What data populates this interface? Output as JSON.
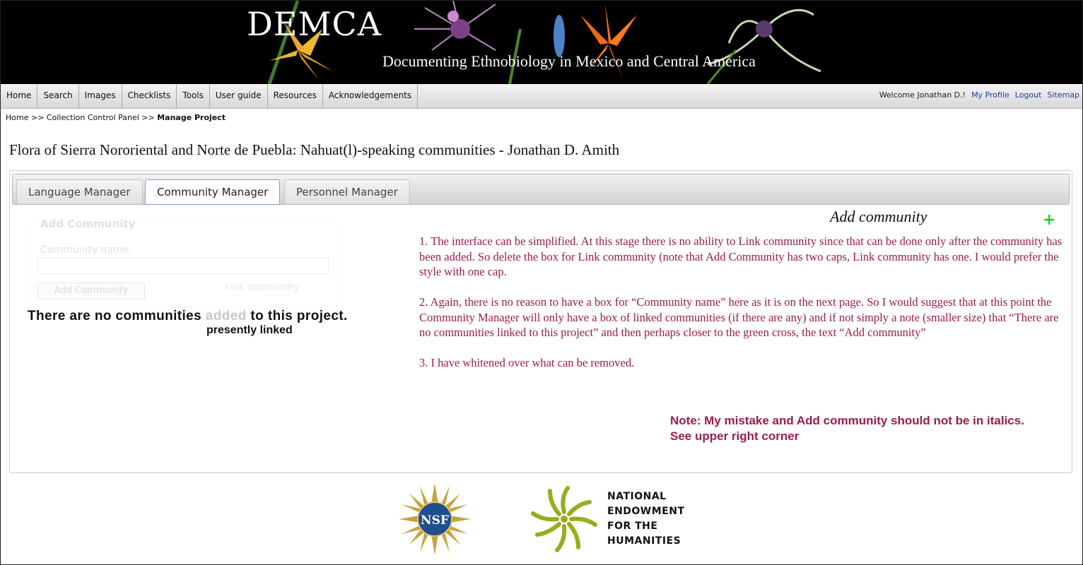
{
  "banner": {
    "title": "DEMCA",
    "subtitle": "Documenting Ethnobiology in Mexico and Central America"
  },
  "nav": {
    "items": [
      "Home",
      "Search",
      "Images",
      "Checklists",
      "Tools",
      "User guide",
      "Resources",
      "Acknowledgements"
    ],
    "welcome": "Welcome Jonathan D.!",
    "my_profile": "My Profile",
    "logout": "Logout",
    "sitemap": "Sitemap"
  },
  "breadcrumb": {
    "home": "Home",
    "sep": ">>",
    "control_panel": "Collection Control Panel",
    "current": "Manage Project"
  },
  "page_title": "Flora of Sierra Nororiental and Norte de Puebla: Nahuat(l)-speaking communities - Jonathan D. Amith",
  "tabs": [
    "Language Manager",
    "Community Manager",
    "Personnel Manager"
  ],
  "active_tab": "Community Manager",
  "faded_form": {
    "legend": "Add Community",
    "label": "Community name:",
    "add_button": "Add Community",
    "link_button": "Link community"
  },
  "status": {
    "part1": "There are no communities ",
    "faded": "added",
    "part2": " to this project.",
    "insert": "presently linked"
  },
  "annotation": {
    "add_community": "Add community",
    "plus": "+",
    "notes": [
      "1. The interface can be simplified. At this stage there is no ability to Link community  since that can be done only after the community has been added. So delete the box for Link community (note that Add Community has two caps, Link community has one. I would prefer the style with one cap.",
      "2. Again, there is no reason to have a box for “Community name” here as it is on the next page. So I would suggest that at this point the Community Manager will only have a box of linked communities (if there are any) and if not simply a note (smaller size) that “There are no communities linked to this project” and then perhaps closer to the green cross, the text “Add community”",
      "3. I have whitened over what can be removed."
    ],
    "mistake_note": "Note: My mistake and Add community should not be in italics. See upper right corner"
  },
  "footer": {
    "nsf_text": "NSF",
    "neh_lines": [
      "NATIONAL",
      "ENDOWMENT",
      "FOR THE",
      "HUMANITIES"
    ]
  },
  "colors": {
    "annotation": "#9b1c4f",
    "plus": "#1fd01f",
    "link": "#1a3f9c",
    "neh_green": "#9aab1e",
    "nsf_gold": "#c9a23a",
    "nsf_blue": "#1f4f8f"
  }
}
